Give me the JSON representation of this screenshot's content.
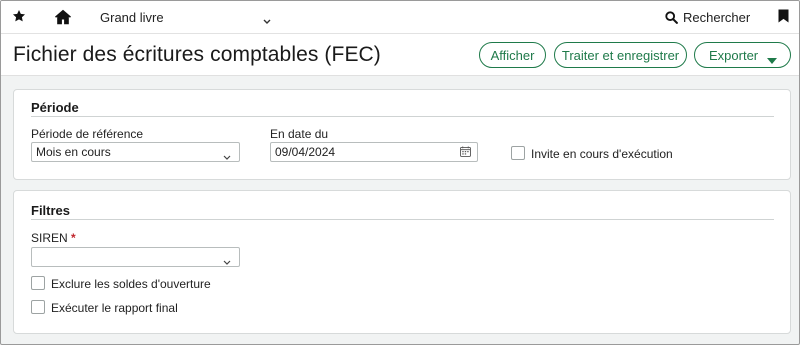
{
  "topbar": {
    "module": "Grand livre",
    "search_label": "Rechercher"
  },
  "header": {
    "title": "Fichier des écritures comptables (FEC)",
    "actions": {
      "afficher": "Afficher",
      "traiter": "Traiter et enregistrer",
      "exporter": "Exporter"
    }
  },
  "periode": {
    "title": "Période",
    "reference_label": "Période de référence",
    "reference_value": "Mois en cours",
    "date_label": "En date du",
    "date_value": "09/04/2024",
    "invite_label": "Invite en cours d'exécution"
  },
  "filtres": {
    "title": "Filtres",
    "siren_label": "SIREN",
    "siren_required": "*",
    "siren_value": "",
    "exclude_label": "Exclure les soldes d'ouverture",
    "final_report_label": "Exécuter le rapport final"
  },
  "colors": {
    "accent": "#1f7a4a",
    "required": "#c0262d",
    "background": "#f1f3f3"
  },
  "icons": [
    "star-icon",
    "home-icon",
    "chevron-down-icon",
    "search-icon",
    "bookmark-icon",
    "calendar-icon",
    "caret-down-icon"
  ]
}
